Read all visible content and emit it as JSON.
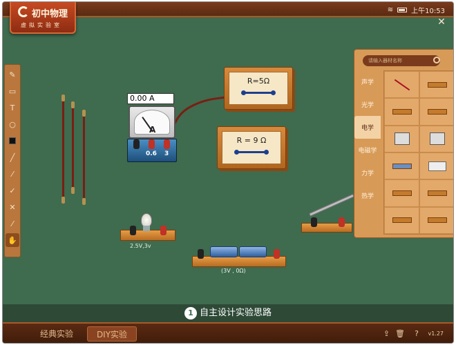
{
  "status": {
    "time": "上午10:53"
  },
  "app": {
    "title": "初中物理",
    "subtitle": "虚拟实验室"
  },
  "tools": [
    "pencil",
    "rect",
    "text",
    "circle",
    "fill",
    "line",
    "eyedropper",
    "marker",
    "delete",
    "brush",
    "hand"
  ],
  "ammeter": {
    "reading": "0.00 A",
    "terminal_1": "0.6",
    "terminal_2": "3"
  },
  "resistors": [
    {
      "label": "R=5Ω"
    },
    {
      "label": "R = 9 Ω"
    }
  ],
  "lamp": {
    "label": "2.5Ⅴ,3v"
  },
  "battery": {
    "label": "(3V , 0Ω)"
  },
  "panel": {
    "search_placeholder": "请输入器材名称",
    "categories": [
      "声学",
      "光学",
      "电学",
      "电磁学",
      "力学",
      "热学"
    ],
    "selected_category": "电学"
  },
  "hint": {
    "number": "1",
    "text": "自主设计实验思路"
  },
  "bottom": {
    "tab_classic": "经典实验",
    "tab_diy": "DIY实验",
    "version": "v1.27"
  }
}
